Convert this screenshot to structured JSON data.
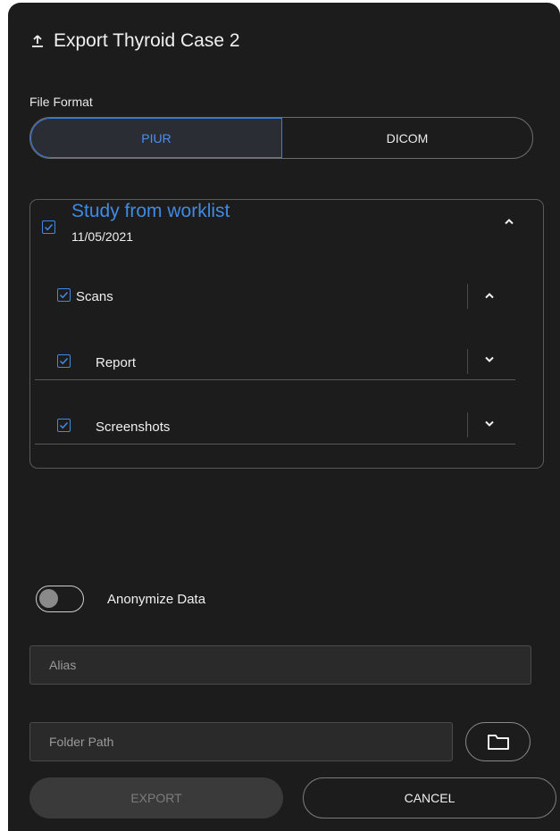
{
  "dialog": {
    "title": "Export Thyroid Case 2",
    "title_icon": "upload-icon"
  },
  "file_format": {
    "label": "File Format",
    "options": [
      "PIUR",
      "DICOM"
    ],
    "selected": "PIUR"
  },
  "study": {
    "title": "Study from worklist",
    "date": "11/05/2021",
    "checked": true,
    "expanded": true,
    "items": [
      {
        "label": "Scans",
        "checked": true,
        "expanded": true
      },
      {
        "label": "Report",
        "checked": true,
        "expanded": false
      },
      {
        "label": "Screenshots",
        "checked": true,
        "expanded": false
      }
    ]
  },
  "anonymize": {
    "label": "Anonymize Data",
    "enabled": false
  },
  "alias": {
    "placeholder": "Alias"
  },
  "folder_path": {
    "placeholder": "Folder Path",
    "browse_icon": "folder-icon"
  },
  "actions": {
    "export_label": "EXPORT",
    "export_enabled": false,
    "cancel_label": "CANCEL"
  },
  "colors": {
    "background": "#1c1c1c",
    "accent": "#3f8ae6",
    "text": "#f0f0f0"
  }
}
